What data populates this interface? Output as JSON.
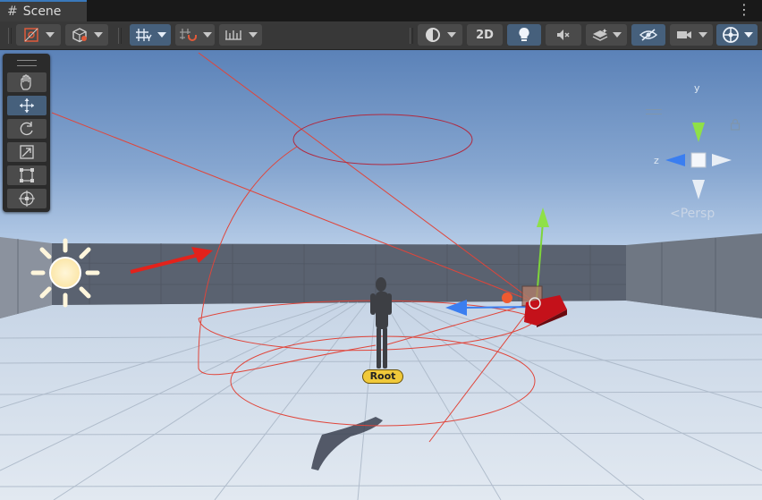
{
  "window": {
    "tab_title": "Scene",
    "tab_icon": "hash-icon",
    "menu_icon": "kebab-menu-icon"
  },
  "toolbar": {
    "draw_mode_icon": "shading-mode-icon",
    "gizmo_icon": "cube-icon",
    "grid_snap_icon": "grid-snap-icon",
    "increment_snap_icon": "snap-increment-icon",
    "ruler_icon": "ruler-icon",
    "render_icon": "render-mode-icon",
    "two_d_label": "2D",
    "light_icon": "lightbulb-icon",
    "audio_icon": "audio-mute-icon",
    "effects_icon": "effects-icon",
    "visibility_icon": "hidden-eye-icon",
    "camera_icon": "camera-icon",
    "gizmos_icon": "gizmo-globe-icon",
    "two_d_active": false,
    "light_active": true,
    "visibility_active": true,
    "gizmos_active": true
  },
  "tools": [
    {
      "icon": "hand-icon",
      "active": false
    },
    {
      "icon": "move-icon",
      "active": true
    },
    {
      "icon": "rotate-icon",
      "active": false
    },
    {
      "icon": "scale-icon",
      "active": false
    },
    {
      "icon": "rect-icon",
      "active": false
    },
    {
      "icon": "transform-icon",
      "active": false
    }
  ],
  "scene": {
    "object_label": "Root",
    "projection_label": "Persp",
    "orientation_axes": [
      "y",
      "z"
    ],
    "colors": {
      "sky_top": "#5b82b8",
      "horizon": "#c0d4ec",
      "floor": "#dbe4ee",
      "wall": "#5a6270",
      "light_gizmo": "#e0453a",
      "axis_x": "#c0201a",
      "axis_y": "#7ed43a",
      "axis_z": "#3a7ef0",
      "label_bg": "#f0c93a"
    }
  }
}
